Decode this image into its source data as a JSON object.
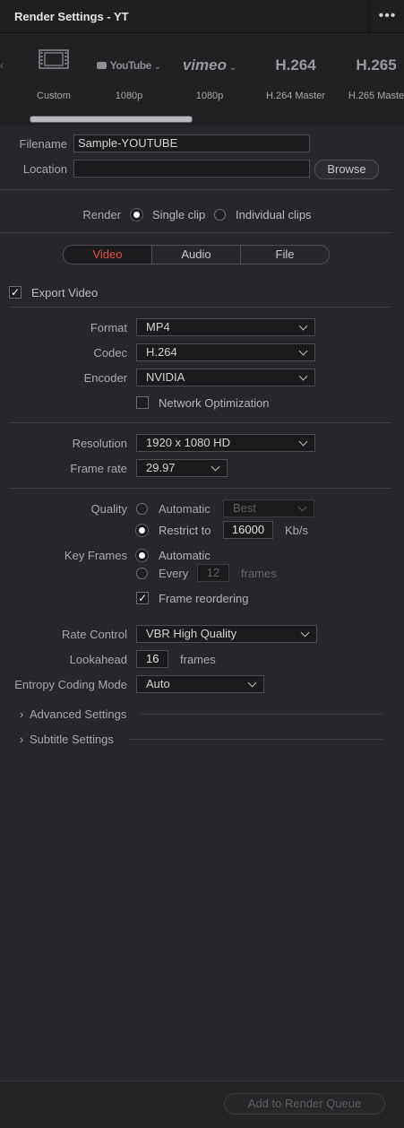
{
  "window": {
    "title": "Render Settings - YT",
    "menu_icon": "more-dots-icon"
  },
  "presets": [
    {
      "name": "Custom",
      "icon": "film-icon",
      "label": "Custom"
    },
    {
      "name": "YouTube",
      "icon_text": "YouTube",
      "label": "1080p"
    },
    {
      "name": "Vimeo",
      "icon_text": "vimeo",
      "label": "1080p"
    },
    {
      "name": "H.264",
      "icon_text": "H.264",
      "label": "H.264 Master"
    },
    {
      "name": "H.265",
      "icon_text": "H.265",
      "label": "H.265 Maste"
    }
  ],
  "file": {
    "filename_label": "Filename",
    "filename_value": "Sample-YOUTUBE",
    "location_label": "Location",
    "location_value": "",
    "browse_label": "Browse"
  },
  "render": {
    "label": "Render",
    "single_clip": "Single clip",
    "individual_clips": "Individual clips",
    "selected": "single_clip"
  },
  "tabs": {
    "video": "Video",
    "audio": "Audio",
    "file": "File",
    "active": "video"
  },
  "export_video": {
    "label": "Export Video",
    "checked": true
  },
  "format": {
    "label": "Format",
    "value": "MP4"
  },
  "codec": {
    "label": "Codec",
    "value": "H.264"
  },
  "encoder": {
    "label": "Encoder",
    "value": "NVIDIA"
  },
  "network_optimization": {
    "label": "Network Optimization",
    "checked": false
  },
  "resolution": {
    "label": "Resolution",
    "value": "1920 x 1080 HD"
  },
  "frame_rate": {
    "label": "Frame rate",
    "value": "29.97"
  },
  "quality": {
    "label": "Quality",
    "automatic": "Automatic",
    "automatic_value": "Best",
    "restrict_to": "Restrict to",
    "restrict_value": "16000",
    "unit": "Kb/s",
    "selected": "restrict_to"
  },
  "key_frames": {
    "label": "Key Frames",
    "automatic": "Automatic",
    "every": "Every",
    "every_value": "12",
    "every_unit": "frames",
    "selected": "automatic",
    "frame_reordering": "Frame reordering",
    "frame_reordering_checked": true
  },
  "rate_control": {
    "label": "Rate Control",
    "value": "VBR High Quality"
  },
  "lookahead": {
    "label": "Lookahead",
    "value": "16",
    "unit": "frames"
  },
  "entropy": {
    "label": "Entropy Coding Mode",
    "value": "Auto"
  },
  "sections": {
    "advanced": "Advanced Settings",
    "subtitle": "Subtitle Settings"
  },
  "footer": {
    "add_label": "Add to Render Queue"
  },
  "colors": {
    "accent": "#e0523b",
    "background": "#27272b"
  }
}
